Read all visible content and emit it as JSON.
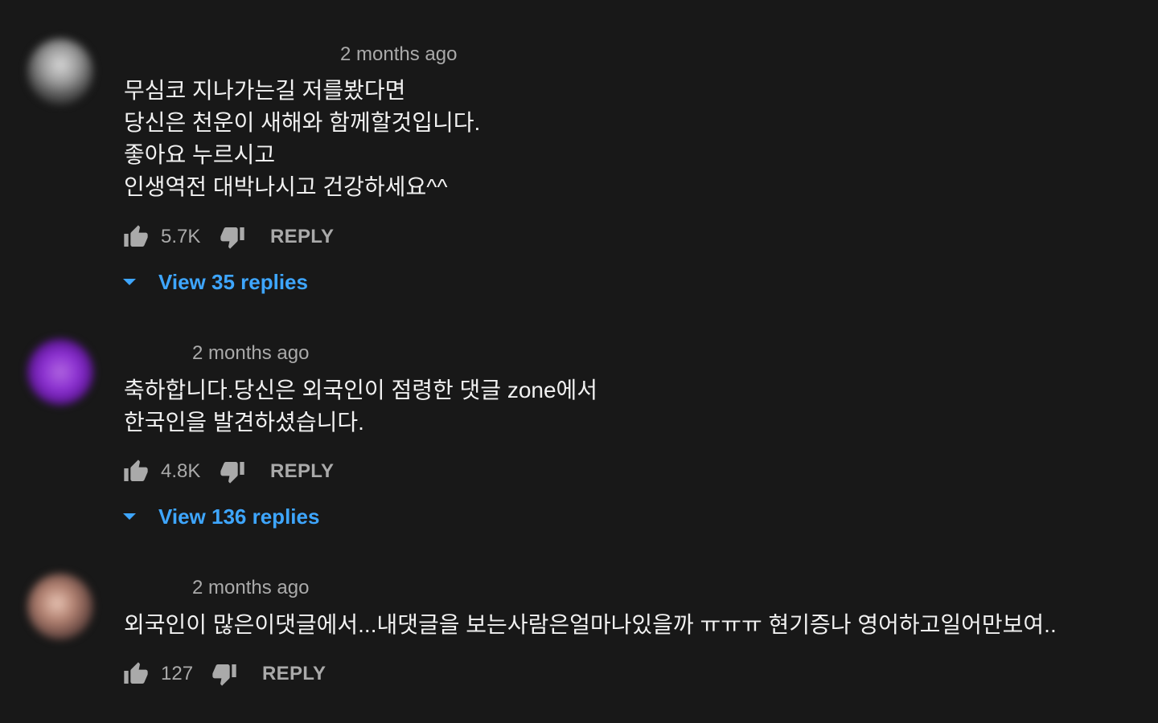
{
  "colors": {
    "background": "#181818",
    "text_primary": "#f1f1f1",
    "text_secondary": "#aaaaaa",
    "link_blue": "#3ea6ff"
  },
  "comments": [
    {
      "timestamp": "2 months ago",
      "lines": [
        "무심코 지나가는길 저를봤다면",
        "당신은 천운이 새해와 함께할것입니다.",
        "좋아요 누르시고",
        "인생역전 대박나시고 건강하세요^^"
      ],
      "likes": "5.7K",
      "reply_label": "REPLY",
      "view_replies": "View 35 replies",
      "like_icon": "thumbs-up-icon",
      "dislike_icon": "thumbs-down-icon"
    },
    {
      "timestamp": "2 months ago",
      "lines": [
        "축하합니다.당신은 외국인이 점령한 댓글 zone에서",
        "한국인을 발견하셨습니다."
      ],
      "likes": "4.8K",
      "reply_label": "REPLY",
      "view_replies": "View 136 replies",
      "like_icon": "thumbs-up-icon",
      "dislike_icon": "thumbs-down-icon"
    },
    {
      "timestamp": "2 months ago",
      "lines": [
        "외국인이 많은이댓글에서...내댓글을 보는사람은얼마나있을까 ㅠㅠㅠ 현기증나 영어하고일어만보여.."
      ],
      "likes": "127",
      "reply_label": "REPLY",
      "like_icon": "thumbs-up-icon",
      "dislike_icon": "thumbs-down-icon"
    }
  ]
}
